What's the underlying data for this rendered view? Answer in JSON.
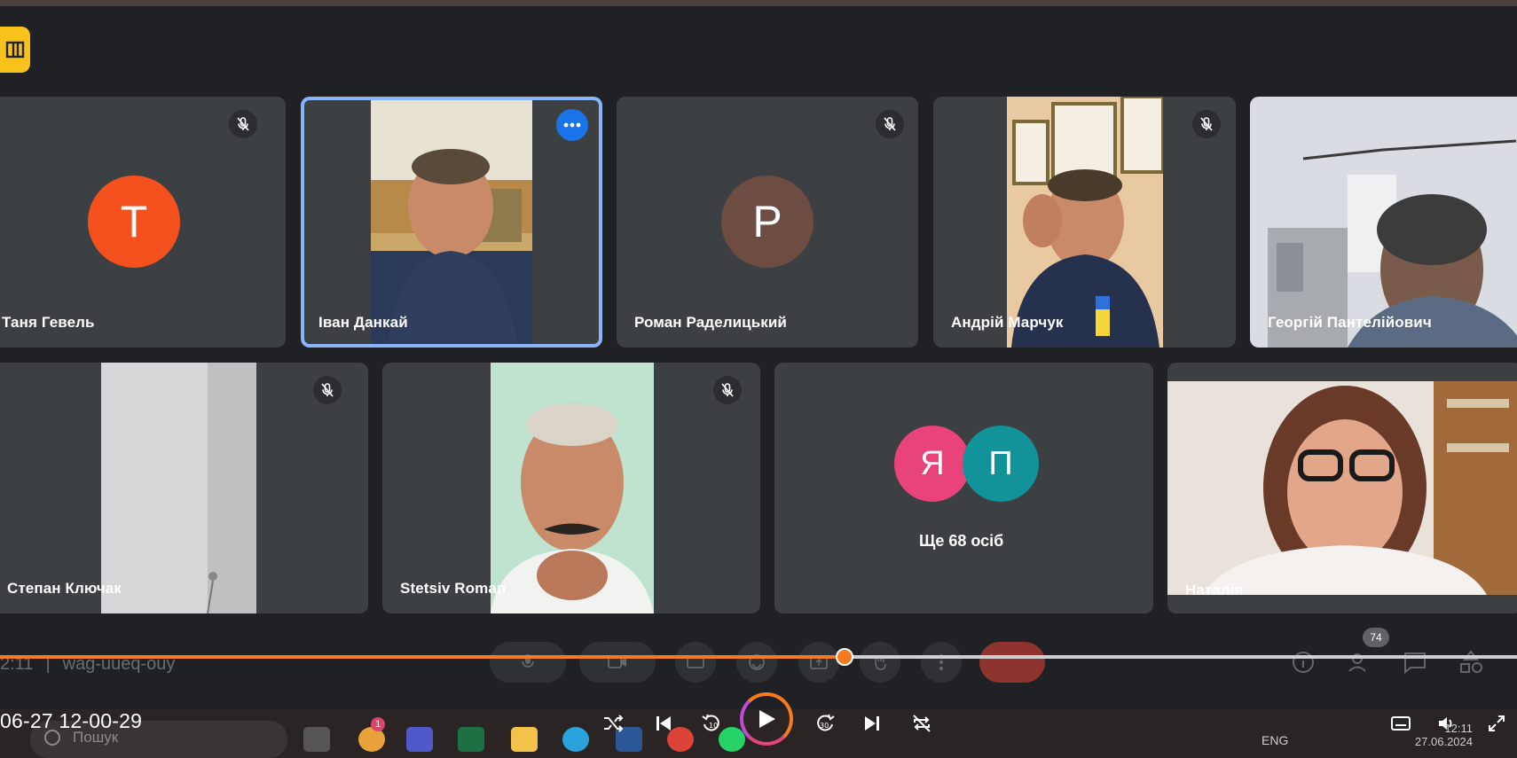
{
  "tiles": {
    "tanya": {
      "name": "Таня Гевель",
      "initial": "Т",
      "avatar_color": "#f4511e"
    },
    "ivan": {
      "name": "Іван Данкай"
    },
    "roman": {
      "name": "Роман Раделицький",
      "initial": "Р",
      "avatar_color": "#6d4c41"
    },
    "andriy": {
      "name": "Андрій Марчук"
    },
    "georgiy": {
      "name": "Георгій Пантелійович"
    },
    "stepan": {
      "name": "Степан Ключак"
    },
    "stetsiv": {
      "name": "Stetsiv Roman"
    },
    "others": {
      "initial_1": "Я",
      "initial_2": "П",
      "label": "Ще 68 осіб",
      "color_1": "#e8437a",
      "color_2": "#12939a"
    },
    "natalia": {
      "name": "Наталія"
    }
  },
  "meeting": {
    "code": "wag-uueq-ouy",
    "time_fragment": "2:11",
    "participant_count": "74"
  },
  "player": {
    "timestamp": "06-27 12-00-29",
    "progress_fraction": 0.557,
    "accent": "#f47b20"
  },
  "taskbar": {
    "search_placeholder": "Пошук",
    "notification_count": "1",
    "language": "ENG",
    "time": "12:11",
    "date": "27.06.2024"
  }
}
